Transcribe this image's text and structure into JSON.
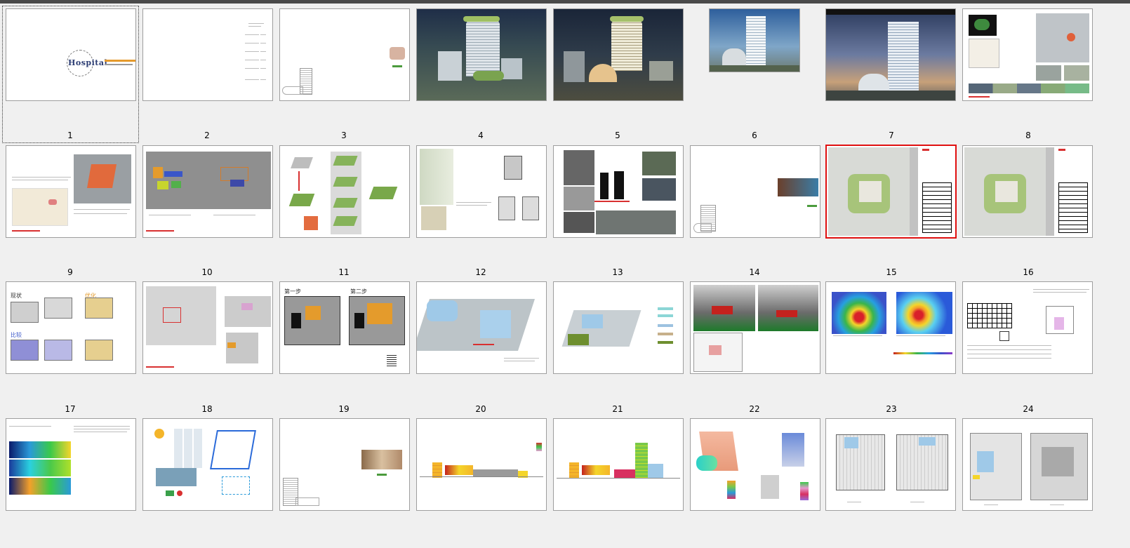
{
  "slides": [
    {
      "num": "1"
    },
    {
      "num": "2"
    },
    {
      "num": "3"
    },
    {
      "num": "4"
    },
    {
      "num": "5"
    },
    {
      "num": "6"
    },
    {
      "num": "7"
    },
    {
      "num": "8"
    },
    {
      "num": "9"
    },
    {
      "num": "10"
    },
    {
      "num": "11"
    },
    {
      "num": "12"
    },
    {
      "num": "13"
    },
    {
      "num": "14"
    },
    {
      "num": "15"
    },
    {
      "num": "16"
    },
    {
      "num": "17"
    },
    {
      "num": "18"
    },
    {
      "num": "19"
    },
    {
      "num": "20"
    },
    {
      "num": "21"
    },
    {
      "num": "22"
    },
    {
      "num": "23"
    },
    {
      "num": "24"
    }
  ],
  "slide1": {
    "logo_text": "Hospital"
  },
  "slide11": {
    "label_a": "第一步",
    "label_b": "第二步"
  },
  "slide17": {
    "label_a": "现状",
    "label_b": "优化",
    "label_c": "比较"
  },
  "selected_slide": "15",
  "colors": {
    "selection": "#e01010",
    "accent_red": "#d83030"
  }
}
